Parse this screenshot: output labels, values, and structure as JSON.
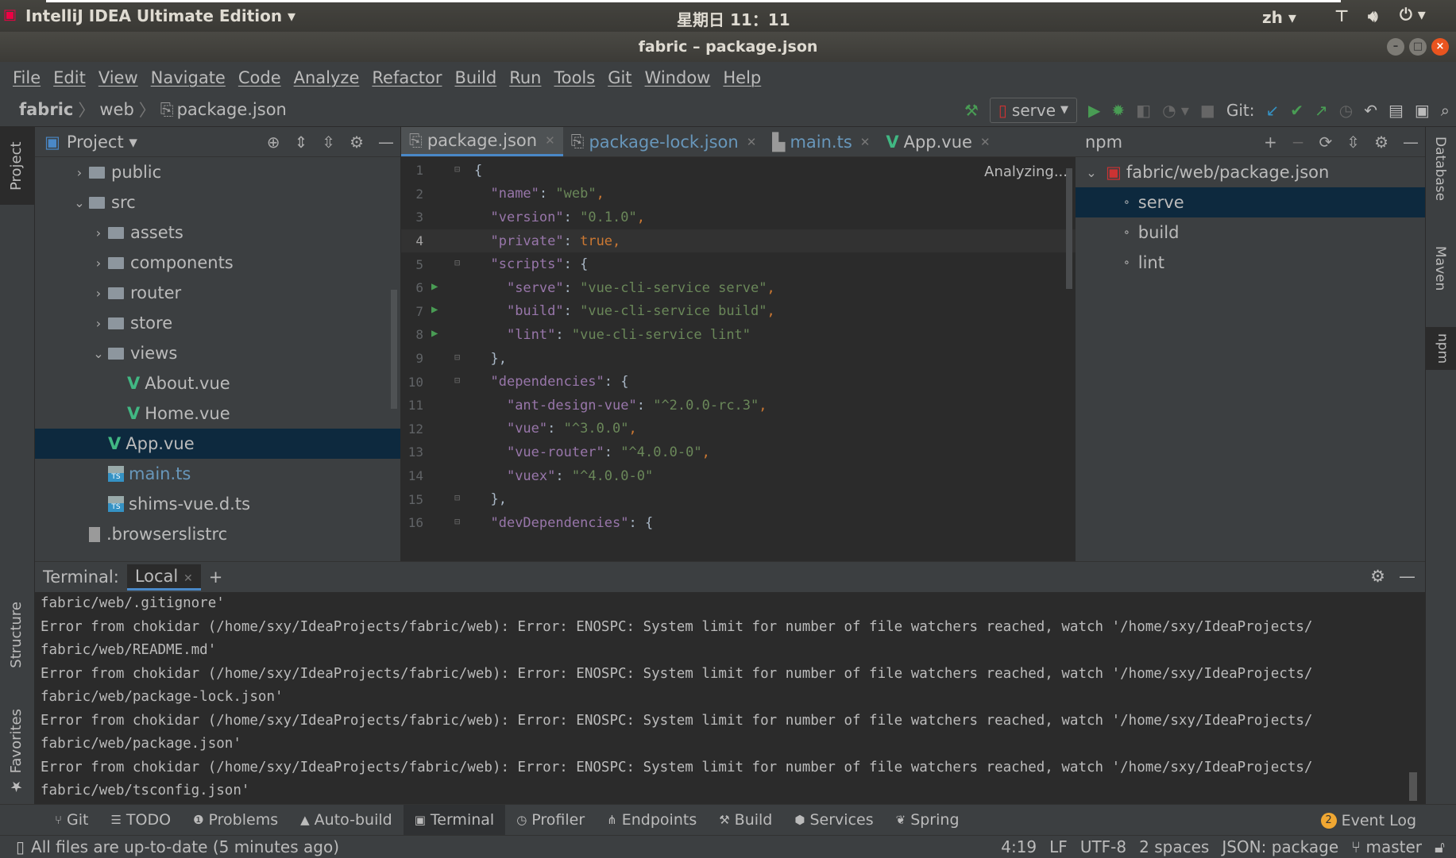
{
  "os": {
    "app_menu": "IntelliJ IDEA Ultimate Edition",
    "clock": "星期日 11：11",
    "input_method": "zh"
  },
  "window": {
    "title": "fabric – package.json"
  },
  "menu": [
    "File",
    "Edit",
    "View",
    "Navigate",
    "Code",
    "Analyze",
    "Refactor",
    "Build",
    "Run",
    "Tools",
    "Git",
    "Window",
    "Help"
  ],
  "breadcrumb": [
    "fabric",
    "web",
    "package.json"
  ],
  "toolbar": {
    "run_config": "serve",
    "git_label": "Git:"
  },
  "left_stripe": {
    "project": "Project",
    "structure": "Structure",
    "favorites": "Favorites"
  },
  "right_stripe": {
    "database": "Database",
    "maven": "Maven",
    "npm": "npm"
  },
  "project": {
    "title": "Project",
    "tree": [
      {
        "label": "public",
        "type": "folder",
        "depth": 1,
        "expanded": false
      },
      {
        "label": "src",
        "type": "folder",
        "depth": 1,
        "expanded": true
      },
      {
        "label": "assets",
        "type": "folder",
        "depth": 2,
        "expanded": false
      },
      {
        "label": "components",
        "type": "folder",
        "depth": 2,
        "expanded": false
      },
      {
        "label": "router",
        "type": "folder",
        "depth": 2,
        "expanded": false
      },
      {
        "label": "store",
        "type": "folder",
        "depth": 2,
        "expanded": false
      },
      {
        "label": "views",
        "type": "folder",
        "depth": 2,
        "expanded": true
      },
      {
        "label": "About.vue",
        "type": "vue",
        "depth": 3
      },
      {
        "label": "Home.vue",
        "type": "vue",
        "depth": 3
      },
      {
        "label": "App.vue",
        "type": "vue",
        "depth": 2,
        "selected": true
      },
      {
        "label": "main.ts",
        "type": "ts",
        "depth": 2,
        "modified": true
      },
      {
        "label": "shims-vue.d.ts",
        "type": "ts",
        "depth": 2
      },
      {
        "label": ".browserslistrc",
        "type": "file",
        "depth": 1
      }
    ]
  },
  "editor": {
    "tabs": [
      {
        "label": "package.json",
        "icon": "json",
        "active": true
      },
      {
        "label": "package-lock.json",
        "icon": "json",
        "modified": true
      },
      {
        "label": "main.ts",
        "icon": "ts",
        "modified": true
      },
      {
        "label": "App.vue",
        "icon": "vue"
      }
    ],
    "status": "Analyzing...",
    "current_line": 4,
    "lines": [
      [
        [
          "{",
          "p"
        ]
      ],
      [
        [
          "  ",
          ""
        ],
        [
          "\"name\"",
          "k"
        ],
        [
          ": ",
          "p"
        ],
        [
          "\"web\"",
          "s"
        ],
        [
          ",",
          "w"
        ]
      ],
      [
        [
          "  ",
          ""
        ],
        [
          "\"version\"",
          "k"
        ],
        [
          ": ",
          "p"
        ],
        [
          "\"0.1.0\"",
          "s"
        ],
        [
          ",",
          "w"
        ]
      ],
      [
        [
          "  ",
          ""
        ],
        [
          "\"private\"",
          "k"
        ],
        [
          ": ",
          "p"
        ],
        [
          "true",
          "w"
        ],
        [
          ",",
          "w"
        ]
      ],
      [
        [
          "  ",
          ""
        ],
        [
          "\"scripts\"",
          "k"
        ],
        [
          ": {",
          "p"
        ]
      ],
      [
        [
          "    ",
          ""
        ],
        [
          "\"serve\"",
          "k"
        ],
        [
          ": ",
          "p"
        ],
        [
          "\"vue-cli-service serve\"",
          "s"
        ],
        [
          ",",
          "w"
        ]
      ],
      [
        [
          "    ",
          ""
        ],
        [
          "\"build\"",
          "k"
        ],
        [
          ": ",
          "p"
        ],
        [
          "\"vue-cli-service build\"",
          "s"
        ],
        [
          ",",
          "w"
        ]
      ],
      [
        [
          "    ",
          ""
        ],
        [
          "\"lint\"",
          "k"
        ],
        [
          ": ",
          "p"
        ],
        [
          "\"vue-cli-service lint\"",
          "s"
        ]
      ],
      [
        [
          "  },",
          ""
        ]
      ],
      [
        [
          "  ",
          ""
        ],
        [
          "\"dependencies\"",
          "k"
        ],
        [
          ": {",
          "p"
        ]
      ],
      [
        [
          "    ",
          ""
        ],
        [
          "\"ant-design-vue\"",
          "k"
        ],
        [
          ": ",
          "p"
        ],
        [
          "\"^2.0.0-rc.3\"",
          "s"
        ],
        [
          ",",
          "w"
        ]
      ],
      [
        [
          "    ",
          ""
        ],
        [
          "\"vue\"",
          "k"
        ],
        [
          ": ",
          "p"
        ],
        [
          "\"^3.0.0\"",
          "s"
        ],
        [
          ",",
          "w"
        ]
      ],
      [
        [
          "    ",
          ""
        ],
        [
          "\"vue-router\"",
          "k"
        ],
        [
          ": ",
          "p"
        ],
        [
          "\"^4.0.0-0\"",
          "s"
        ],
        [
          ",",
          "w"
        ]
      ],
      [
        [
          "    ",
          ""
        ],
        [
          "\"vuex\"",
          "k"
        ],
        [
          ": ",
          "p"
        ],
        [
          "\"^4.0.0-0\"",
          "s"
        ]
      ],
      [
        [
          "  },",
          ""
        ]
      ],
      [
        [
          "  ",
          ""
        ],
        [
          "\"devDependencies\"",
          "k"
        ],
        [
          ": {",
          "p"
        ]
      ]
    ],
    "run_lines": [
      6,
      7,
      8
    ],
    "fold_lines": [
      1,
      5,
      9,
      10,
      15,
      16
    ]
  },
  "npm": {
    "title": "npm",
    "root": "fabric/web/package.json",
    "scripts": [
      "serve",
      "build",
      "lint"
    ],
    "selected": "serve"
  },
  "terminal": {
    "label": "Terminal:",
    "tab": "Local",
    "lines": [
      "fabric/web/.gitignore'",
      "Error from chokidar (/home/sxy/IdeaProjects/fabric/web): Error: ENOSPC: System limit for number of file watchers reached, watch '/home/sxy/IdeaProjects/",
      "fabric/web/README.md'",
      "Error from chokidar (/home/sxy/IdeaProjects/fabric/web): Error: ENOSPC: System limit for number of file watchers reached, watch '/home/sxy/IdeaProjects/",
      "fabric/web/package-lock.json'",
      "Error from chokidar (/home/sxy/IdeaProjects/fabric/web): Error: ENOSPC: System limit for number of file watchers reached, watch '/home/sxy/IdeaProjects/",
      "fabric/web/package.json'",
      "Error from chokidar (/home/sxy/IdeaProjects/fabric/web): Error: ENOSPC: System limit for number of file watchers reached, watch '/home/sxy/IdeaProjects/",
      "fabric/web/tsconfig.json'"
    ]
  },
  "tool_windows": [
    {
      "label": "Git",
      "icon": "git-icon",
      "glyph": "⑂"
    },
    {
      "label": "TODO",
      "icon": "todo-icon",
      "glyph": "☰"
    },
    {
      "label": "Problems",
      "icon": "problems-icon",
      "glyph": "❶"
    },
    {
      "label": "Auto-build",
      "icon": "warning-icon",
      "glyph": "▲"
    },
    {
      "label": "Terminal",
      "icon": "terminal-icon",
      "glyph": "▣",
      "active": true
    },
    {
      "label": "Profiler",
      "icon": "profiler-icon",
      "glyph": "◷"
    },
    {
      "label": "Endpoints",
      "icon": "endpoints-icon",
      "glyph": "⋔"
    },
    {
      "label": "Build",
      "icon": "hammer-icon",
      "glyph": "⚒"
    },
    {
      "label": "Services",
      "icon": "services-icon",
      "glyph": "⬢"
    },
    {
      "label": "Spring",
      "icon": "spring-icon",
      "glyph": "❦"
    }
  ],
  "event_log": {
    "label": "Event Log",
    "count": "2"
  },
  "status": {
    "message": "All files are up-to-date (5 minutes ago)",
    "position": "4:19",
    "line_sep": "LF",
    "encoding": "UTF-8",
    "indent": "2 spaces",
    "schema": "JSON: package",
    "branch": "master"
  },
  "colors": {
    "selection": "#0d293e",
    "key": "#9876aa",
    "string": "#6a8759",
    "keyword": "#cc7832",
    "vue": "#41b883",
    "run": "#499c54"
  }
}
